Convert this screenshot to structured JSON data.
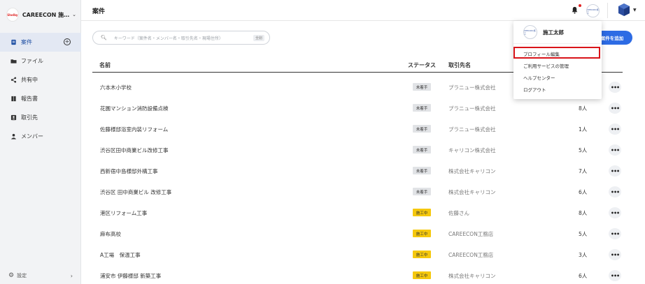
{
  "sidebar": {
    "org_logo_text": "Shelby",
    "org_name": "CAREECON 施…",
    "items": [
      {
        "label": "案件",
        "icon": "project-icon",
        "active": true
      },
      {
        "label": "ファイル",
        "icon": "folder-icon",
        "active": false
      },
      {
        "label": "共有中",
        "icon": "share-icon",
        "active": false
      },
      {
        "label": "報告書",
        "icon": "report-icon",
        "active": false
      },
      {
        "label": "取引先",
        "icon": "contact-icon",
        "active": false
      },
      {
        "label": "メンバー",
        "icon": "person-icon",
        "active": false
      }
    ],
    "add_symbol": "+",
    "settings_label": "設定"
  },
  "header": {
    "title": "案件",
    "avatar_text": "CEECON 施工",
    "notification": true
  },
  "search": {
    "placeholder": "キーワード（案件名・メンバー名・取引先名・現場住所）",
    "clear_label": "全削"
  },
  "add_project_label": "案件を追加",
  "table": {
    "headers": {
      "name": "名前",
      "status": "ステータス",
      "client": "取引先名"
    },
    "rows": [
      {
        "name": "六本木小学校",
        "status": "未着手",
        "status_color": "gray",
        "client": "プラニュー株式会社",
        "members": ""
      },
      {
        "name": "花園マンション消防設備点検",
        "status": "未着手",
        "status_color": "gray",
        "client": "プラニュー株式会社",
        "members": "8人"
      },
      {
        "name": "佐藤様邸浴室内装リフォーム",
        "status": "未着手",
        "status_color": "gray",
        "client": "プラニュー株式会社",
        "members": "1人"
      },
      {
        "name": "渋谷区田中商業ビル改修工事",
        "status": "未着手",
        "status_color": "gray",
        "client": "キャリコン株式会社",
        "members": "5人"
      },
      {
        "name": "西新宿中島様邸外構工事",
        "status": "未着手",
        "status_color": "gray",
        "client": "株式会社キャリコン",
        "members": "7人"
      },
      {
        "name": "渋谷区 田中商業ビル 改修工事",
        "status": "未着手",
        "status_color": "gray",
        "client": "株式会社キャリコン",
        "members": "6人"
      },
      {
        "name": "港区リフォーム工事",
        "status": "施工中",
        "status_color": "yellow",
        "client": "佐藤さん",
        "members": "8人"
      },
      {
        "name": "麻布高校",
        "status": "施工中",
        "status_color": "yellow",
        "client": "CAREECON工務店",
        "members": "5人"
      },
      {
        "name": "A工場　保温工事",
        "status": "施工中",
        "status_color": "yellow",
        "client": "CAREECON工務店",
        "members": "3人"
      },
      {
        "name": "浦安市 伊藤様邸 新築工事",
        "status": "施工中",
        "status_color": "yellow",
        "client": "株式会社キャリコン",
        "members": "6人"
      }
    ]
  },
  "user_menu": {
    "avatar_text": "CEECON 施工",
    "username": "施工太郎",
    "items": [
      "プロフィール編集",
      "ご利用サービスの管理",
      "ヘルプセンター",
      "ログアウト"
    ],
    "highlighted": "プロフィール編集"
  },
  "colors": {
    "accent": "#2d6be4",
    "highlight": "#d9141a",
    "status_yellow": "#f5c80e",
    "status_gray": "#e1e3e6"
  }
}
